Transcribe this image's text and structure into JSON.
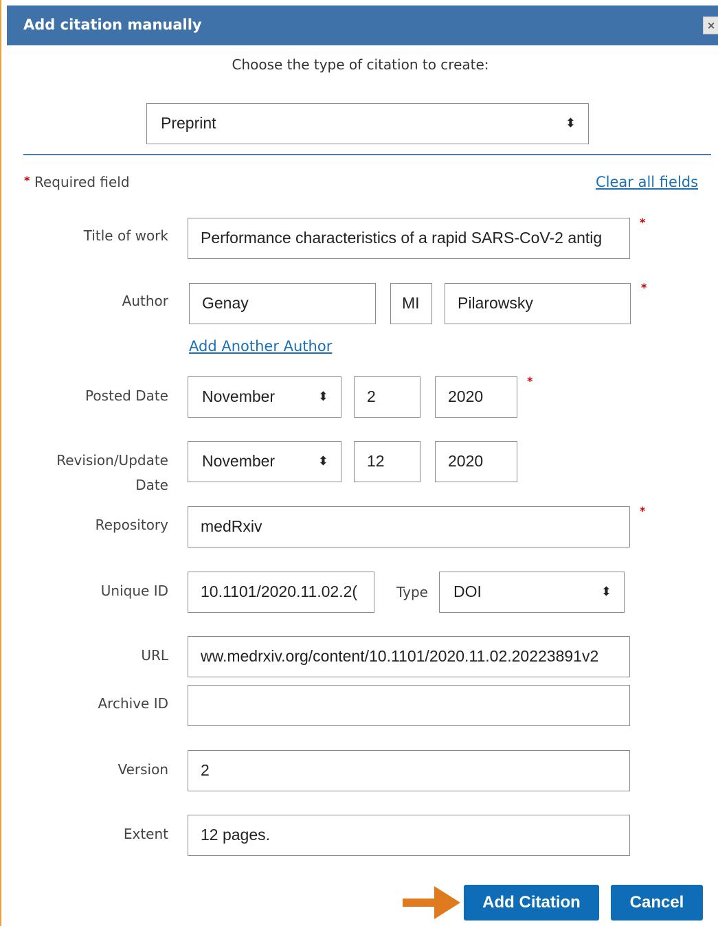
{
  "dialog": {
    "title": "Add citation manually",
    "close_label": "×"
  },
  "type_chooser": {
    "prompt": "Choose the type of citation to create:",
    "selected": "Preprint"
  },
  "form": {
    "required_note": "Required field",
    "required_star": "*",
    "clear_all": "Clear all fields",
    "title_of_work": {
      "label": "Title of work",
      "value": "Performance characteristics of a rapid SARS-CoV-2 antig"
    },
    "author": {
      "label": "Author",
      "first": "Genay",
      "middle": "MI",
      "last": "Pilarowsky",
      "add_another": "Add Another Author"
    },
    "posted_date": {
      "label": "Posted Date",
      "month": "November",
      "day": "2",
      "year": "2020"
    },
    "revision_date": {
      "label_line1": "Revision/Update",
      "label_line2": "Date",
      "month": "November",
      "day": "12",
      "year": "2020"
    },
    "repository": {
      "label": "Repository",
      "value": "medRxiv"
    },
    "unique_id": {
      "label": "Unique ID",
      "value": "10.1101/2020.11.02.2(",
      "type_label": "Type",
      "type_value": "DOI"
    },
    "url": {
      "label": "URL",
      "value": "ww.medrxiv.org/content/10.1101/2020.11.02.20223891v2"
    },
    "archive_id": {
      "label": "Archive ID",
      "value": ""
    },
    "version": {
      "label": "Version",
      "value": "2"
    },
    "extent": {
      "label": "Extent",
      "value": "12 pages."
    }
  },
  "actions": {
    "add_citation": "Add Citation",
    "cancel": "Cancel"
  },
  "colors": {
    "titlebar": "#3e72a8",
    "button": "#0f6db7",
    "link": "#1a6fb5",
    "required": "#cc0000",
    "arrow": "#e07a1f"
  },
  "icons": {
    "close": "close-icon",
    "select_arrows": "sort-arrows-icon",
    "pointer": "arrow-pointer-icon"
  }
}
